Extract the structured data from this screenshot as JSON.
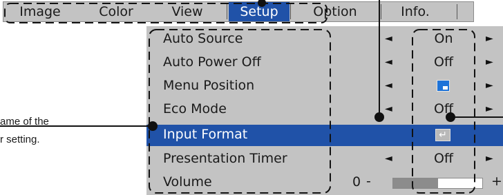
{
  "menu_tabs": [
    {
      "label": "Image",
      "selected": false
    },
    {
      "label": "Color",
      "selected": false
    },
    {
      "label": "View",
      "selected": false
    },
    {
      "label": "Setup",
      "selected": true
    },
    {
      "label": "Option",
      "selected": false
    },
    {
      "label": "Info.",
      "selected": false
    }
  ],
  "menu_items": {
    "auto_source": {
      "label": "Auto Source",
      "value": "On"
    },
    "auto_power_off": {
      "label": "Auto Power Off",
      "value": "Off"
    },
    "menu_position": {
      "label": "Menu Position"
    },
    "eco_mode": {
      "label": "Eco Mode",
      "value": "Off"
    },
    "input_format": {
      "label": "Input Format"
    },
    "presentation_timer": {
      "label": "Presentation Timer",
      "value": "Off"
    },
    "volume": {
      "label": "Volume",
      "min_label": "0",
      "minus": "-",
      "plus": "+",
      "level": 0.5
    }
  },
  "icons": {
    "left_arrow": "◄",
    "right_arrow": "►",
    "enter": "↵"
  },
  "callout": {
    "line1": "ame of the",
    "line2": "r setting."
  },
  "colors": {
    "menu_background": "#c3c3c3",
    "selection": "#2052a8",
    "menu_position_icon": "#1e73d8"
  }
}
